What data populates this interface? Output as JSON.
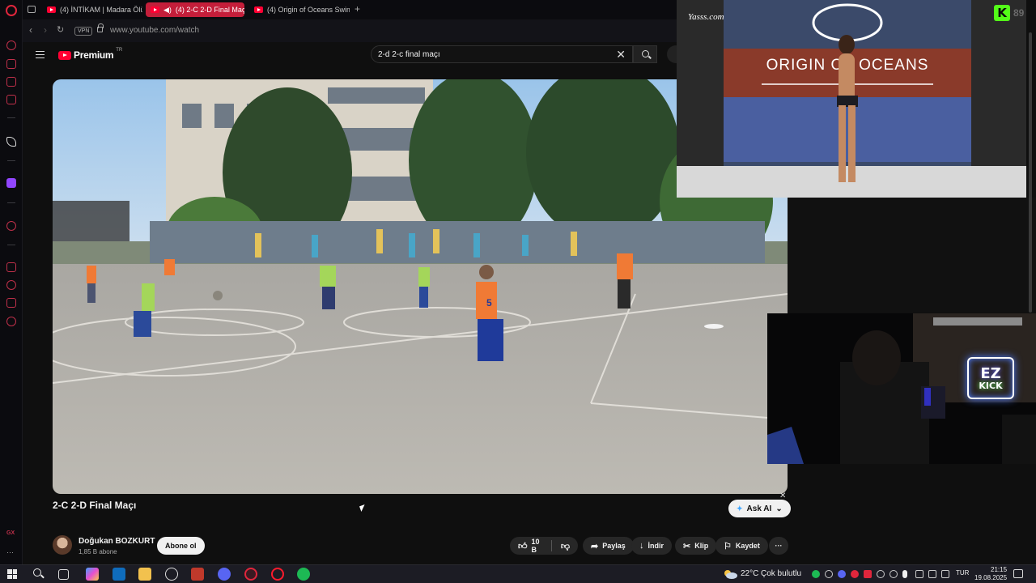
{
  "browser": {
    "tabs": [
      {
        "label": "(4) İNTİKAM | Madara Ölü",
        "active": false
      },
      {
        "label": "(4) 2-C 2-D Final Maç",
        "active": true
      },
      {
        "label": "(4) Origin of Oceans Swim",
        "active": false
      }
    ],
    "new_tab_glyph": "+",
    "vpn_label": "VPN",
    "url": "www.youtube.com/watch",
    "sidebar_icons": [
      "opera-icon",
      "refresh-icon",
      "bag-icon",
      "wallet-icon",
      "news-icon",
      "ai-icon",
      "twitch-icon",
      "music-icon",
      "box-icon",
      "history-icon",
      "star-icon",
      "settings-icon",
      "gx-icon",
      "more-icon"
    ]
  },
  "youtube": {
    "logo_text": "Premium",
    "logo_region": "TR",
    "search_query": "2-d 2-c final maçı",
    "clear_glyph": "✕"
  },
  "video": {
    "title": "2-C 2-D Final Maçı",
    "ask_ai_label": "Ask AI",
    "channel_name": "Doğukan BOZKURT",
    "subscribers": "1,85 B abone",
    "subscribe_label": "Abone ol",
    "likes": "10 B",
    "share_label": "Paylaş",
    "download_label": "İndir",
    "clip_label": "Klip",
    "save_label": "Kaydet",
    "more_glyph": "···",
    "jersey_number": "5"
  },
  "overlay": {
    "runway_watermark": "Yasss.com",
    "runway_brand": "ORIGIN OF OCEANS",
    "kick_letter": "K",
    "kick_stat": "89",
    "ez_line1": "EZ",
    "ez_line2": "KICK"
  },
  "taskbar": {
    "temperature": "22°C",
    "condition": "Çok bulutlu",
    "language": "TUR",
    "time": "21:15",
    "date": "19.08.2025"
  },
  "colors": {
    "accent": "#c41e3a",
    "youtube_red": "#ff0033",
    "kick_green": "#53fc18"
  }
}
